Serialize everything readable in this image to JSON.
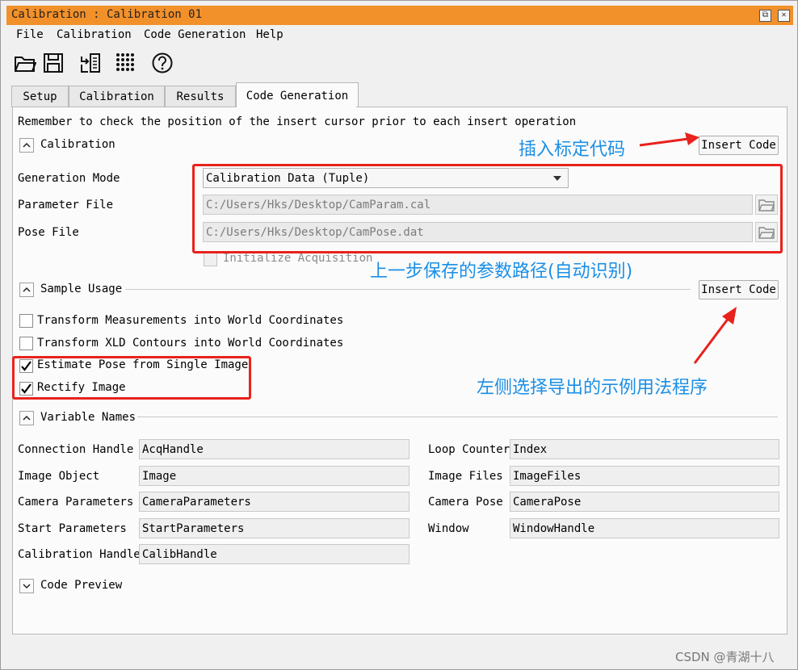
{
  "window": {
    "title": "Calibration : Calibration 01"
  },
  "menu": [
    {
      "label": "File"
    },
    {
      "label": "Calibration"
    },
    {
      "label": "Code Generation"
    },
    {
      "label": "Help"
    }
  ],
  "toolbar": [
    "open-folder-icon",
    "save-icon",
    "insert-code-icon",
    "calibration-grid-icon",
    "help-icon"
  ],
  "tabs": [
    {
      "label": "Setup"
    },
    {
      "label": "Calibration"
    },
    {
      "label": "Results"
    },
    {
      "label": "Code Generation",
      "active": true
    }
  ],
  "panel": {
    "hint": "Remember to check the position of the insert cursor prior to each insert operation",
    "calibration_section": {
      "title": "Calibration",
      "insert_code_label": "Insert Code",
      "generation_mode_label": "Generation Mode",
      "generation_mode_value": "Calibration Data (Tuple)",
      "parameter_file_label": "Parameter File",
      "parameter_file_value": "C:/Users/Hks/Desktop/CamParam.cal",
      "pose_file_label": "Pose File",
      "pose_file_value": "C:/Users/Hks/Desktop/CamPose.dat",
      "init_acq_label": "Initialize Acquisition"
    },
    "sample_section": {
      "title": "Sample Usage",
      "insert_code_label": "Insert Code",
      "options": [
        {
          "label": "Transform Measurements into World Coordinates",
          "checked": false
        },
        {
          "label": "Transform XLD Contours into World Coordinates",
          "checked": false
        },
        {
          "label": "Estimate Pose from Single Image",
          "checked": true
        },
        {
          "label": "Rectify Image",
          "checked": true
        }
      ]
    },
    "variables_section": {
      "title": "Variable Names",
      "left": [
        {
          "label": "Connection Handle",
          "value": "AcqHandle"
        },
        {
          "label": "Image Object",
          "value": "Image"
        },
        {
          "label": "Camera Parameters",
          "value": "CameraParameters"
        },
        {
          "label": "Start Parameters",
          "value": "StartParameters"
        },
        {
          "label": "Calibration Handle",
          "value": "CalibHandle"
        }
      ],
      "right": [
        {
          "label": "Loop Counter",
          "value": "Index"
        },
        {
          "label": "Image Files",
          "value": "ImageFiles"
        },
        {
          "label": "Camera Pose",
          "value": "CameraPose"
        },
        {
          "label": "Window",
          "value": "WindowHandle"
        }
      ]
    },
    "preview_section": {
      "title": "Code Preview"
    }
  },
  "annotations": {
    "insert": "插入标定代码",
    "path": "上一步保存的参数路径(自动识别)",
    "choose": "左侧选择导出的示例用法程序",
    "color": "#1b8fe6",
    "box_color": "#e8221c"
  },
  "watermark": "CSDN @青湖十八"
}
